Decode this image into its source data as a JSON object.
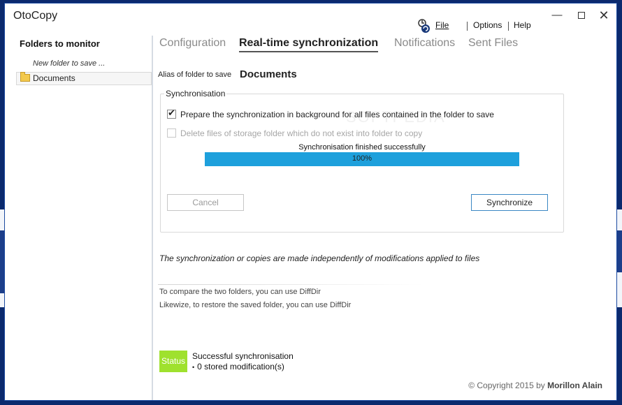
{
  "window": {
    "title": "OtoCopy",
    "controls": {
      "minimize": "—",
      "close": "✕"
    }
  },
  "menu": {
    "file": "File",
    "options": "Options",
    "help": "Help"
  },
  "left_panel": {
    "title": "Folders to monitor",
    "new_folder": "New folder to save ...",
    "folders": [
      "Documents"
    ]
  },
  "tabs": [
    {
      "label": "Configuration",
      "active": false
    },
    {
      "label": "Real-time synchronization",
      "active": true
    },
    {
      "label": "Notifications",
      "active": false
    },
    {
      "label": "Sent Files",
      "active": false
    }
  ],
  "alias": {
    "label": "Alias of folder to save",
    "value": "Documents"
  },
  "sync": {
    "group_label": "Synchronisation",
    "option_background": {
      "label": "Prepare the synchronization in background for all files contained in the folder to save",
      "checked": true,
      "enabled": true
    },
    "option_delete": {
      "label": "Delete files of storage folder which do not exist into folder to copy",
      "checked": false,
      "enabled": false
    },
    "progress_message": "Synchronisation finished successfully",
    "progress_percent": 100,
    "progress_label": "100%",
    "cancel_label": "Cancel",
    "synchronize_label": "Synchronize"
  },
  "notes": {
    "main": "The synchronization or copies are made independently of modifications applied to files",
    "compare": "To compare the two folders, you can use DiffDir",
    "restore": "Likewize, to restore the saved folder, you can use DiffDir"
  },
  "status": {
    "badge": "Status",
    "line1": "Successful synchronisation",
    "line2": "0 stored modification(s)",
    "bullet": "•"
  },
  "footer": {
    "copyright": "© Copyright 2015 by",
    "author": "Morillon Alain"
  },
  "watermark": "SOFTPEDIA",
  "colors": {
    "progress_fill": "#1ea0dc",
    "status_badge": "#9fe12e",
    "synchronize_border": "#3b88c4"
  }
}
